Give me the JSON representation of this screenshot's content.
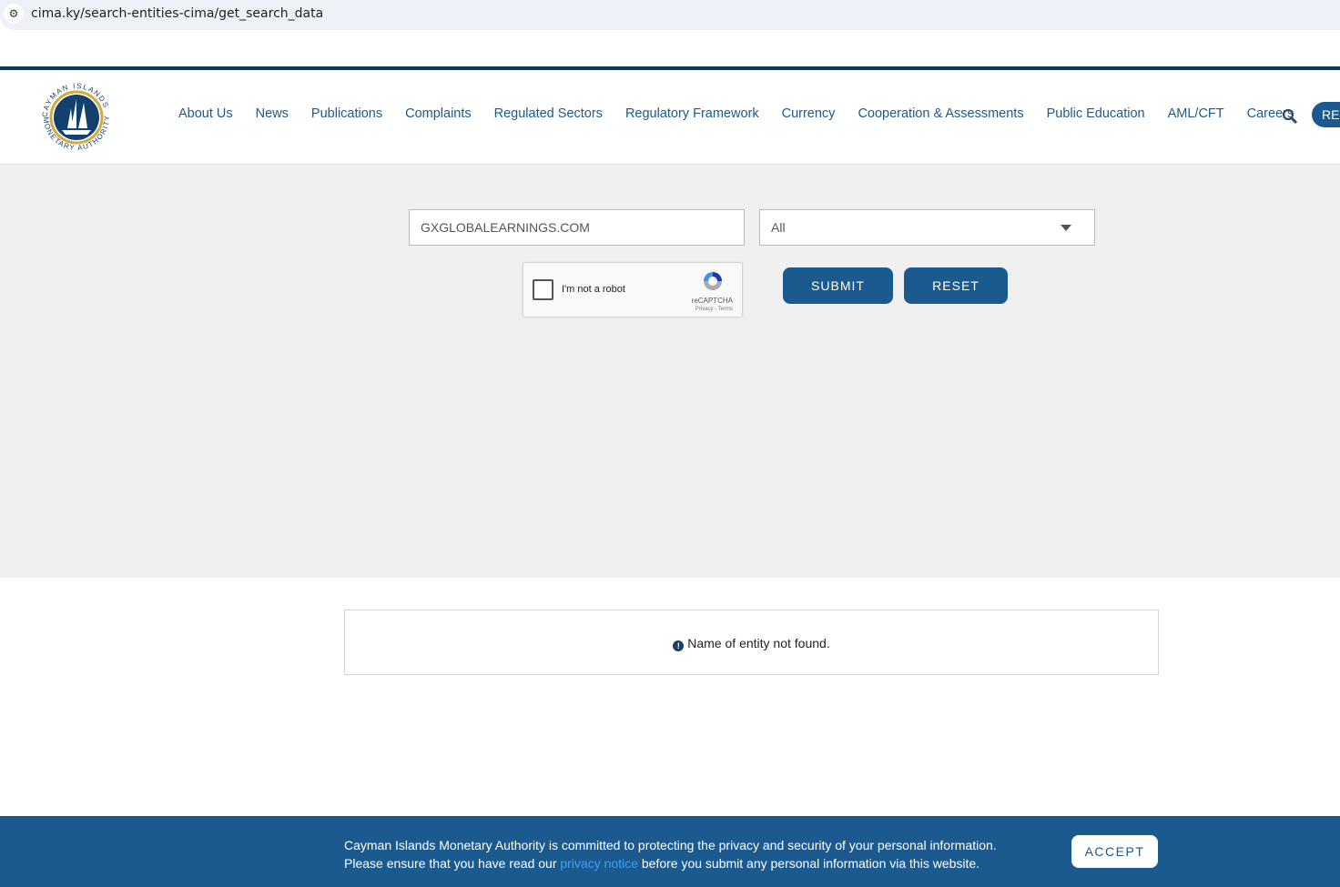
{
  "browser": {
    "url": "cima.ky/search-entities-cima/get_search_data"
  },
  "header": {
    "logo_text": "CAYMAN ISLANDS MONETARY AUTHORITY",
    "nav": [
      "About Us",
      "News",
      "Publications",
      "Complaints",
      "Regulated Sectors",
      "Regulatory Framework",
      "Currency",
      "Cooperation & Assessments",
      "Public Education",
      "AML/CFT",
      "Careers"
    ],
    "cta_label": "REG"
  },
  "search": {
    "query": "GXGLOBALEARNINGS.COM",
    "category": "All",
    "captcha_label": "I'm not a robot",
    "captcha_brand": "reCAPTCHA",
    "captcha_links": "Privacy - Terms",
    "submit": "SUBMIT",
    "reset": "RESET"
  },
  "result": {
    "message": "Name of entity not found."
  },
  "footer": {
    "line1": "Cayman Islands Monetary Authority is committed to protecting the privacy and security of your personal information.",
    "line2_pre": "Please ensure that you have read our ",
    "link": "privacy notice",
    "line2_post": " before you submit any personal information via this website.",
    "accept": "ACCEPT"
  }
}
